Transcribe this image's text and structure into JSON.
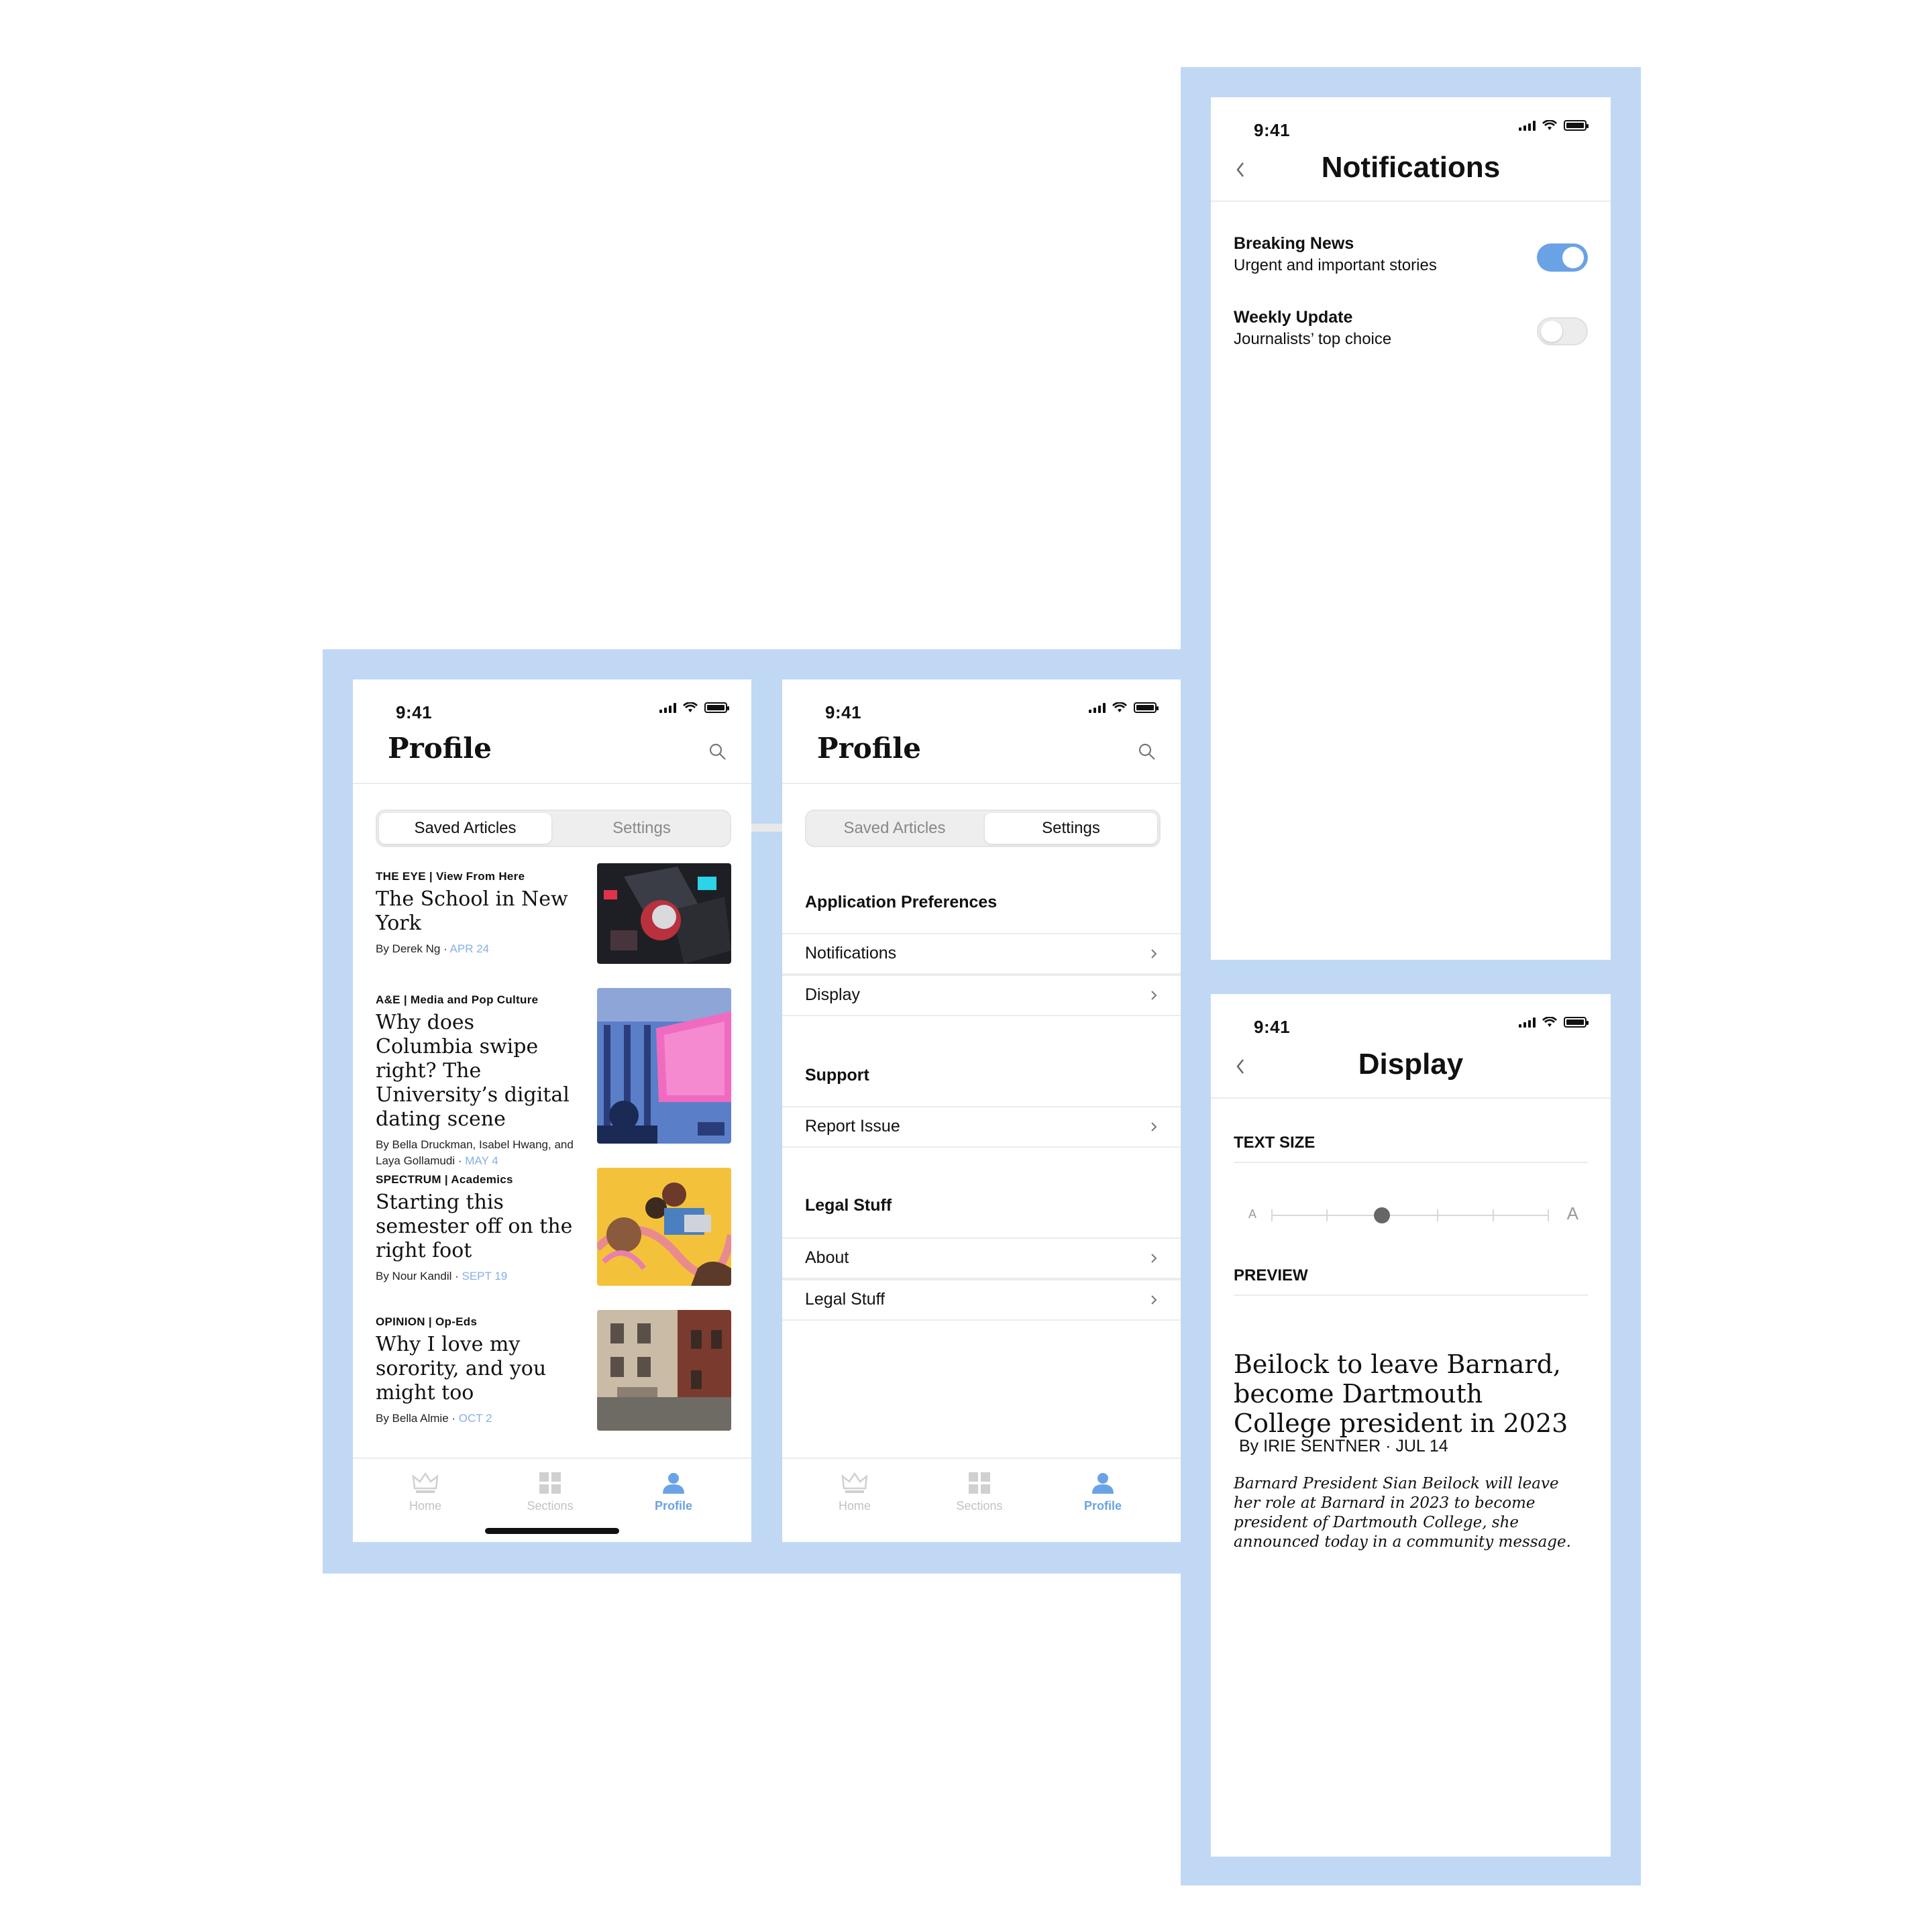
{
  "status_time": "9:41",
  "profile_saved": {
    "title": "Profile",
    "tabs": {
      "saved": "Saved Articles",
      "settings": "Settings"
    },
    "articles": [
      {
        "section": "THE EYE | View From Here",
        "headline": "The School in New York",
        "byline": "By Derek Ng · ",
        "date": "APR 24"
      },
      {
        "section": "A&E | Media and Pop Culture",
        "headline": "Why does Columbia swipe right? The University’s digital dating scene",
        "byline": "By Bella Druckman, Isabel Hwang, and Laya Gollamudi · ",
        "date": "MAY 4"
      },
      {
        "section": "SPECTRUM | Academics",
        "headline": "Starting this semester off on the right foot",
        "byline": "By Nour Kandil · ",
        "date": "SEPT 19"
      },
      {
        "section": "OPINION | Op-Eds",
        "headline": "Why I love my sorority, and you might too",
        "byline": "By Bella Almie · ",
        "date": "OCT 2"
      }
    ]
  },
  "tabbar": {
    "home": "Home",
    "sections": "Sections",
    "profile": "Profile"
  },
  "profile_settings": {
    "title": "Profile",
    "groups": {
      "app_prefs": {
        "heading": "Application Preferences",
        "items": [
          "Notifications",
          "Display"
        ]
      },
      "support": {
        "heading": "Support",
        "items": [
          "Report Issue"
        ]
      },
      "legal": {
        "heading": "Legal Stuff",
        "items": [
          "About",
          "Legal Stuff"
        ]
      }
    }
  },
  "notifications": {
    "title": "Notifications",
    "items": [
      {
        "title": "Breaking News",
        "desc": "Urgent and important stories",
        "enabled": true
      },
      {
        "title": "Weekly Update",
        "desc": "Journalists’ top choice",
        "enabled": false
      }
    ]
  },
  "display": {
    "title": "Display",
    "text_size_label": "TEXT SIZE",
    "text_size": {
      "small_glyph": "A",
      "large_glyph": "A",
      "steps": 6,
      "selected_step": 2
    },
    "preview_label": "PREVIEW",
    "preview": {
      "headline": "Beilock to leave Barnard, become Dartmouth College president in 2023",
      "byline": "By IRIE SENTNER · JUL 14",
      "body": "Barnard President Sian Beilock will leave her role at Barnard in 2023 to become president of Dartmouth College, she announced today in a community message."
    }
  },
  "colors": {
    "accent": "#6aa2e6",
    "frame_bg": "#c0d8f4",
    "date": "#86aee8"
  }
}
